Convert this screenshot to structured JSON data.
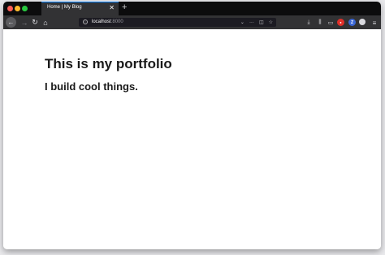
{
  "browser": {
    "tab": {
      "title": "Home | My Blog",
      "close_icon": "close-icon"
    },
    "new_tab_icon": "plus-icon",
    "nav": {
      "back_icon": "back-arrow-icon",
      "forward_icon": "forward-arrow-icon",
      "reload_icon": "reload-icon",
      "home_icon": "home-icon"
    },
    "url": {
      "host": "localhost",
      "port": ":8000"
    },
    "url_icons": [
      "chevron-down-icon",
      "more-icon",
      "pocket-icon",
      "bookmark-star-icon"
    ],
    "toolbar_icons": [
      "download-icon",
      "library-icon",
      "sidebar-icon",
      "extension-icon",
      "zotero-icon",
      "account-icon",
      "menu-icon"
    ]
  },
  "page": {
    "title": "This is my portfolio",
    "subtitle": "I build cool things."
  }
}
